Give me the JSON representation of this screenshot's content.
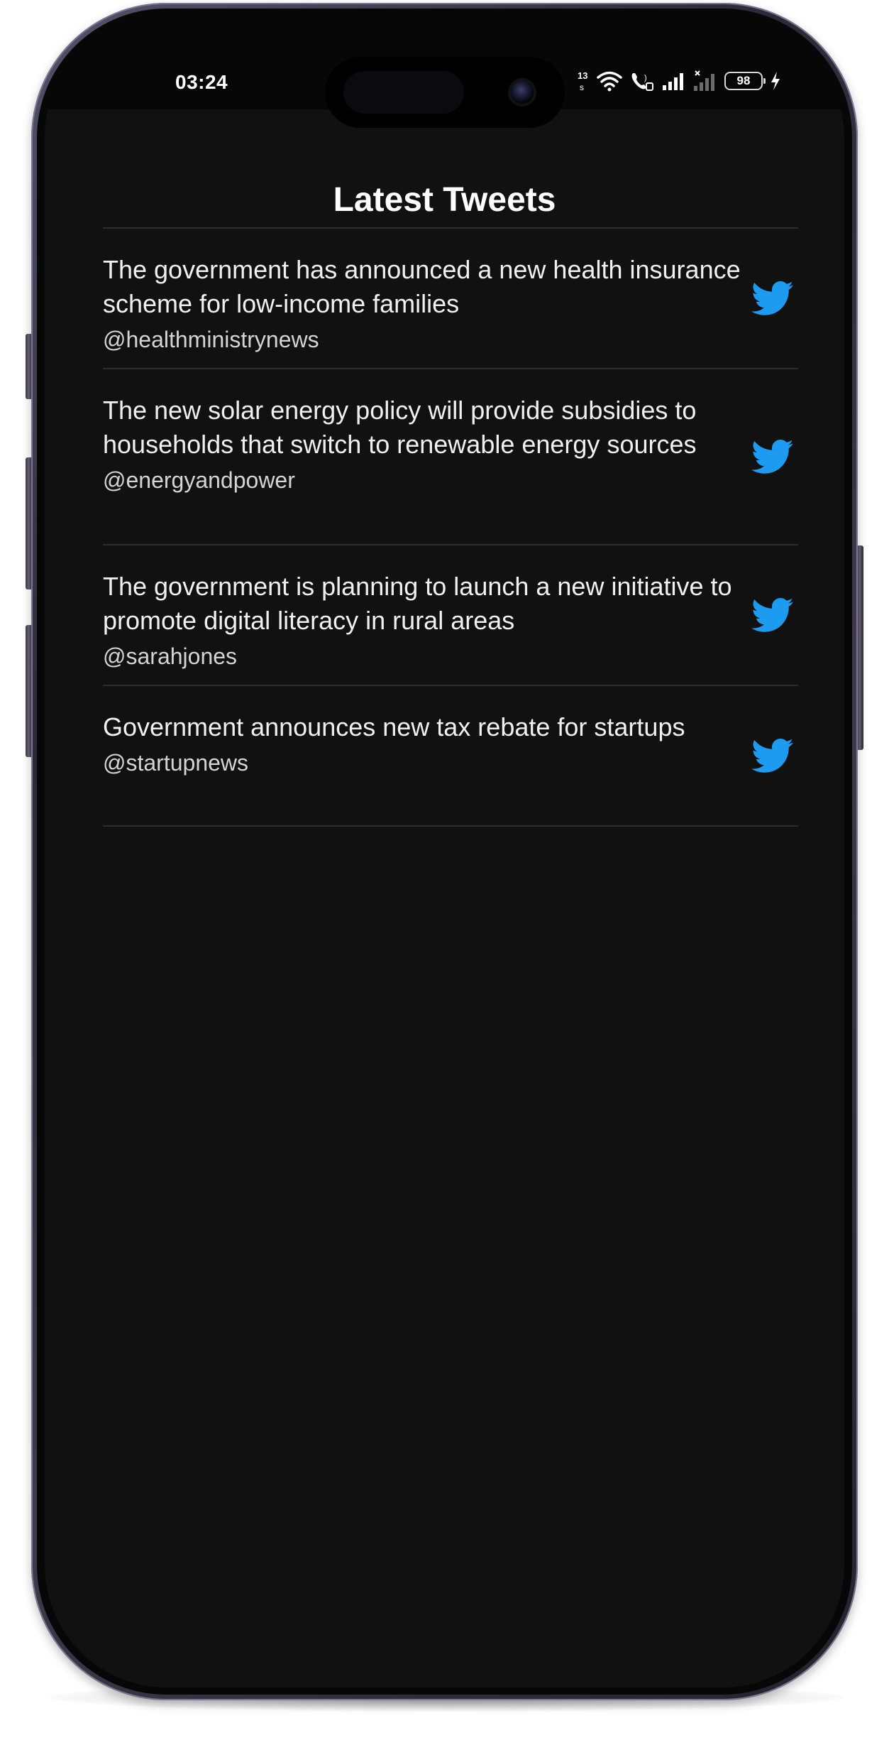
{
  "status_bar": {
    "time": "03:24",
    "network_speed": "13 kB/s",
    "battery_level": "98",
    "icons": [
      "network-speed-icon",
      "wifi-icon",
      "volte-call-icon",
      "signal-icon",
      "no-signal-icon",
      "battery-icon",
      "charging-icon"
    ]
  },
  "page": {
    "title": "Latest Tweets"
  },
  "tweets": [
    {
      "text": "The government has announced a new health insurance scheme for low-income families",
      "handle": "@healthministrynews",
      "icon": "twitter-bird-icon"
    },
    {
      "text": "The new solar energy policy will provide subsidies to households that switch to renewable energy sources",
      "handle": "@energyandpower",
      "icon": "twitter-bird-icon"
    },
    {
      "text": "The government is planning to launch a new initiative to promote digital literacy in rural areas",
      "handle": "@sarahjones",
      "icon": "twitter-bird-icon"
    },
    {
      "text": "Government announces new tax rebate for startups",
      "handle": "@startupnews",
      "icon": "twitter-bird-icon"
    }
  ],
  "colors": {
    "background": "#111111",
    "status_bar": "#070708",
    "text_primary": "#f0f0f0",
    "text_secondary": "#d4d4d4",
    "divider": "#2d2d2d",
    "twitter_blue": "#1d9bf0"
  }
}
